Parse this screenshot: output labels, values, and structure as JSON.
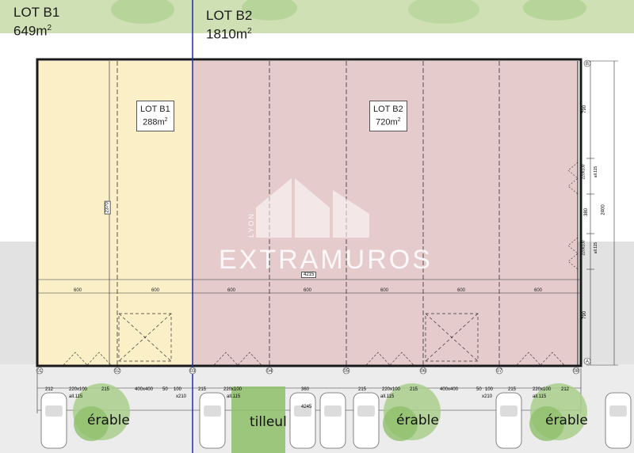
{
  "header_labels": {
    "lot_b1": {
      "name": "LOT B1",
      "area": "649m",
      "unit_sup": "2"
    },
    "lot_b2": {
      "name": "LOT B2",
      "area": "1810m",
      "unit_sup": "2"
    }
  },
  "room_labels": {
    "lot_b1": {
      "name": "LOT B1",
      "area": "288m",
      "unit_sup": "2"
    },
    "lot_b2": {
      "name": "LOT B2",
      "area": "720m",
      "unit_sup": "2"
    }
  },
  "bay_dimension": "600",
  "bay_count": 7,
  "dimensions": {
    "total_length": "4215",
    "total_depth": "2400",
    "depth_top": "790",
    "depth_bottom": "790",
    "opening_1": "220x100",
    "sill_1": "all.115",
    "mid_gap": "380",
    "opening_2": "220x100",
    "sill_2": "all.115",
    "partition": "2370"
  },
  "grid_axes": [
    "01",
    "02",
    "03",
    "04",
    "05",
    "06",
    "07",
    "08"
  ],
  "grid_rows": [
    "B",
    "A"
  ],
  "bottom_dimensions": [
    "212",
    "220x100",
    "215",
    "400x400",
    "50",
    "100",
    "215",
    "220x100",
    "360",
    "215",
    "220x100",
    "215",
    "400x400",
    "50",
    "100",
    "215",
    "220x100",
    "212"
  ],
  "bottom_sub": [
    "all.115",
    "x210",
    "all.115",
    "4245",
    "all.115",
    "x210",
    "all.115"
  ],
  "trees": [
    "érable",
    "tilleul",
    "érable",
    "érable"
  ],
  "watermark": {
    "brand": "EXTRAMUROS",
    "city": "LYON"
  },
  "colors": {
    "lot_b1_fill": "#fbefc7",
    "lot_b2_fill": "#e6cbcc",
    "divider": "#1f2fa8",
    "wall": "#1a1a1a",
    "ground_gray": "#e0e0e0",
    "tree_green": "#8fbf6a"
  }
}
